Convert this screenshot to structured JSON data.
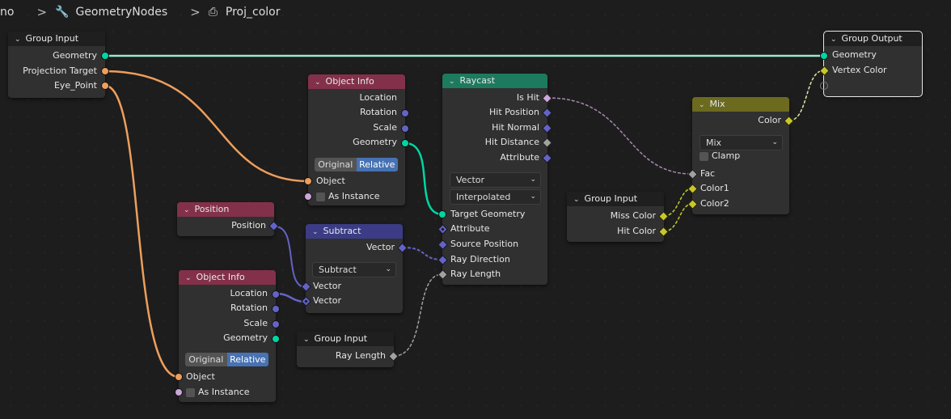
{
  "breadcrumb": {
    "items": [
      "no",
      "GeometryNodes",
      "Proj_color"
    ],
    "icons": [
      "wrench-icon",
      "node-tree-icon"
    ]
  },
  "nodes": {
    "group_input_main": {
      "title": "Group Input",
      "outputs": [
        "Geometry",
        "Projection Target",
        "Eye_Point"
      ]
    },
    "object_info_1": {
      "title": "Object Info",
      "outputs": [
        "Location",
        "Rotation",
        "Scale",
        "Geometry"
      ],
      "transform_options": [
        "Original",
        "Relative"
      ],
      "transform_selected": "Relative",
      "inputs": [
        "Object",
        "As Instance"
      ]
    },
    "raycast": {
      "title": "Raycast",
      "outputs": [
        "Is Hit",
        "Hit Position",
        "Hit Normal",
        "Hit Distance",
        "Attribute"
      ],
      "data_type": "Vector",
      "mapping": "Interpolated",
      "inputs": [
        "Target Geometry",
        "Attribute",
        "Source Position",
        "Ray Direction",
        "Ray Length"
      ]
    },
    "mix": {
      "title": "Mix",
      "outputs": [
        "Color"
      ],
      "blend_mode": "Mix",
      "clamp_label": "Clamp",
      "clamp_checked": false,
      "inputs": [
        "Fac",
        "Color1",
        "Color2"
      ]
    },
    "group_output": {
      "title": "Group Output",
      "inputs": [
        "Geometry",
        "Vertex Color"
      ]
    },
    "group_input_colors": {
      "title": "Group Input",
      "outputs": [
        "Miss Color",
        "Hit Color"
      ]
    },
    "position": {
      "title": "Position",
      "outputs": [
        "Position"
      ]
    },
    "subtract": {
      "title": "Subtract",
      "outputs": [
        "Vector"
      ],
      "operation": "Subtract",
      "inputs": [
        "Vector",
        "Vector"
      ]
    },
    "object_info_2": {
      "title": "Object Info",
      "outputs": [
        "Location",
        "Rotation",
        "Scale",
        "Geometry"
      ],
      "transform_options": [
        "Original",
        "Relative"
      ],
      "transform_selected": "Relative",
      "inputs": [
        "Object",
        "As Instance"
      ]
    },
    "group_input_ray": {
      "title": "Group Input",
      "outputs": [
        "Ray Length"
      ]
    }
  },
  "colors": {
    "geometry_socket": "#00d6a3",
    "object_socket": "#ed9e5c",
    "vector_socket": "#6363c7",
    "boolean_socket": "#cca6d6",
    "float_socket": "#a1a1a1",
    "color_socket": "#c7c729",
    "selected_toggle": "#4772b3"
  }
}
